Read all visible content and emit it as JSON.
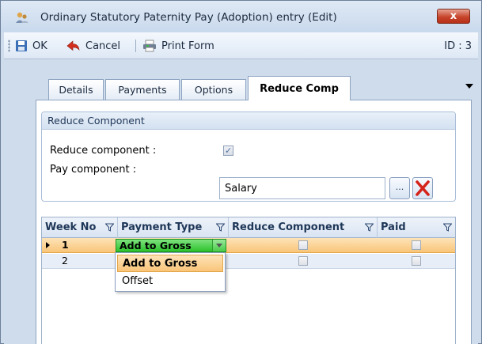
{
  "window": {
    "title": "Ordinary Statutory Paternity Pay (Adoption) entry (Edit)",
    "close_label": "x"
  },
  "toolbar": {
    "ok_label": "OK",
    "cancel_label": "Cancel",
    "print_label": "Print Form",
    "id_label": "ID : 3"
  },
  "tabs": [
    {
      "label": "Details"
    },
    {
      "label": "Payments"
    },
    {
      "label": "Options"
    },
    {
      "label": "Reduce Comp"
    }
  ],
  "reduce_group": {
    "title": "Reduce Component",
    "reduce_label": "Reduce component :",
    "reduce_checked": true,
    "pay_label": "Pay component :",
    "pay_value": "Salary",
    "ellipsis_label": "..."
  },
  "grid": {
    "columns": [
      "Week No",
      "Payment Type",
      "Reduce Component",
      "Paid"
    ],
    "rows": [
      {
        "week": "1",
        "payment_type": "Add to Gross",
        "reduce": false,
        "paid": false
      },
      {
        "week": "2",
        "payment_type": "",
        "reduce": false,
        "paid": false
      }
    ]
  },
  "dropdown": {
    "options": [
      "Add to Gross",
      "Offset"
    ],
    "selected": "Add to Gross"
  },
  "colors": {
    "selected_row": "#f9c579",
    "combo_green": "#2cc22c",
    "close_red": "#c6452c"
  }
}
